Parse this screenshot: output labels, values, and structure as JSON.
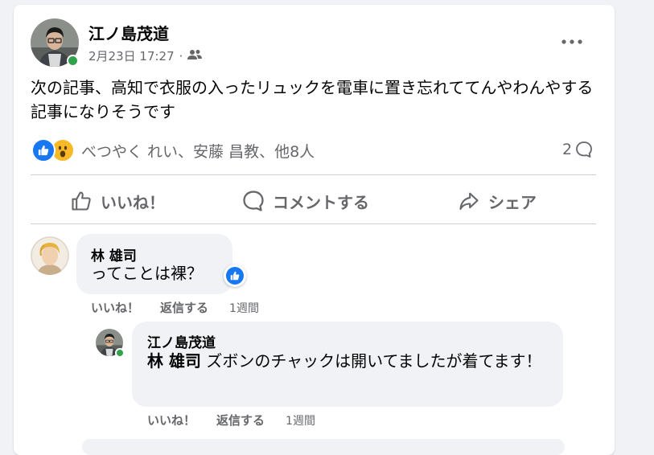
{
  "post": {
    "author": "江ノ島茂道",
    "date": "2月23日 17:27",
    "meta_separator": "·",
    "audience_icon": "friends-icon",
    "more_icon": "more-options-icon",
    "text": "次の記事、高知で衣服の入ったリュックを電車に置き忘れててんやわんやする記事になりそうです",
    "reaction_icons": [
      "like-icon",
      "wow-icon"
    ],
    "reaction_names": "べつやく れい、安藤 昌教、他8人",
    "comment_count": "2"
  },
  "actions": {
    "like_label": "いいね！",
    "comment_label": "コメントする",
    "share_label": "シェア"
  },
  "comments": [
    {
      "author": "林 雄司",
      "text": "ってことは裸？",
      "like_label": "いいね！",
      "reply_label": "返信する",
      "time": "1週間",
      "reaction_icon": "like-icon"
    }
  ],
  "replies": [
    {
      "author": "江ノ島茂道",
      "mention": "林 雄司",
      "text": " ズボンのチャックは開いてましたが着てます！",
      "like_label": "いいね！",
      "reply_label": "返信する",
      "time": "1週間"
    }
  ],
  "colors": {
    "brand_blue": "#1877f2",
    "online_green": "#31a24c",
    "secondary_text": "#65676b",
    "bubble_bg": "#f0f2f5"
  }
}
